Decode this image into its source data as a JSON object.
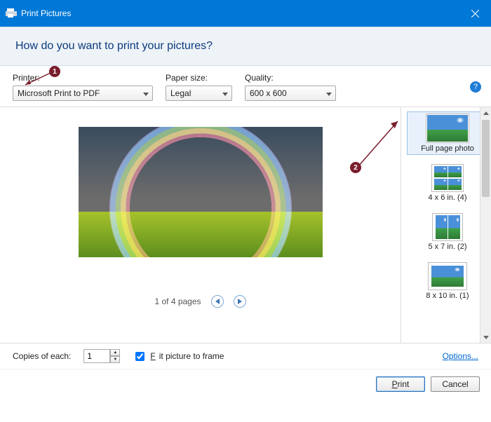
{
  "window": {
    "title": "Print Pictures"
  },
  "header": {
    "question": "How do you want to print your pictures?"
  },
  "controls": {
    "printer": {
      "label": "Printer:",
      "value": "Microsoft Print to PDF"
    },
    "paper": {
      "label": "Paper size:",
      "value": "Legal"
    },
    "quality": {
      "label": "Quality:",
      "value": "600 x 600"
    }
  },
  "annotations": {
    "badge1": "1",
    "badge2": "2"
  },
  "pager": {
    "text": "1 of 4 pages"
  },
  "layouts": {
    "full": {
      "label": "Full page photo"
    },
    "l4x6": {
      "label": "4 x 6 in. (4)"
    },
    "l5x7": {
      "label": "5 x 7 in. (2)"
    },
    "l8x10": {
      "label": "8 x 10 in. (1)"
    }
  },
  "copies": {
    "label": "Copies of each:",
    "value": "1",
    "fit_label": "Fit picture to frame",
    "fit_checked": true
  },
  "links": {
    "options": "Options..."
  },
  "buttons": {
    "print": "Print",
    "cancel": "Cancel"
  }
}
